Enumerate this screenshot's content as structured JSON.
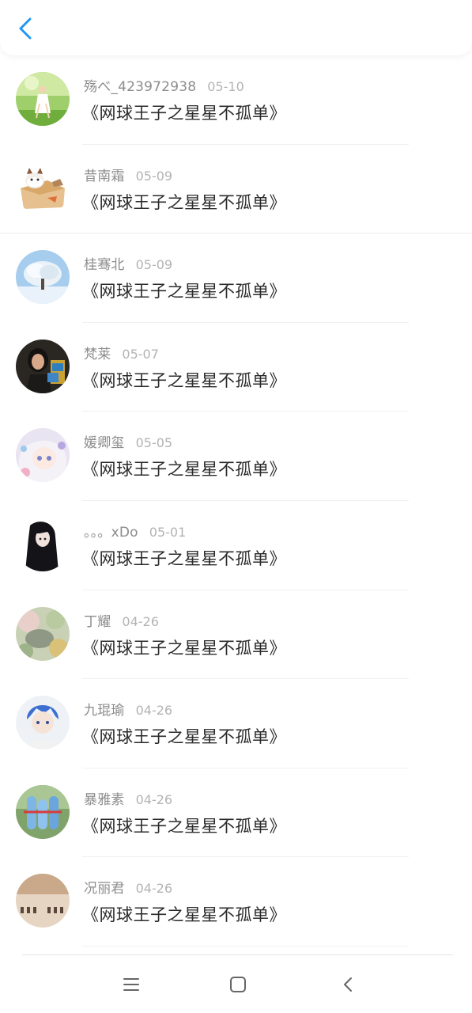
{
  "header": {
    "back_icon": "chevron-left-icon",
    "accent_color": "#2196f3"
  },
  "comments": [
    {
      "name": "殇べ_423972938",
      "date": "05-10",
      "title": "《网球王子之星星不孤单》",
      "avatar": "girl-in-meadow"
    },
    {
      "name": "昔南霜",
      "date": "05-09",
      "title": "《网球王子之星星不孤单》",
      "avatar": "cat-in-box"
    },
    {
      "name": "桂骞北",
      "date": "05-09",
      "title": "《网球王子之星星不孤单》",
      "avatar": "snowy-tree"
    },
    {
      "name": "梵莱",
      "date": "05-07",
      "title": "《网球王子之星星不孤单》",
      "avatar": "woman-portrait"
    },
    {
      "name": "媛卿玺",
      "date": "05-05",
      "title": "《网球王子之星星不孤单》",
      "avatar": "anime-girl"
    },
    {
      "name": "。。。xDo",
      "date": "05-01",
      "title": "《网球王子之星星不孤单》",
      "avatar": "dark-hair-girl"
    },
    {
      "name": "丁耀",
      "date": "04-26",
      "title": "《网球王子之星星不孤单》",
      "avatar": "painted-flowers"
    },
    {
      "name": "九琨瑜",
      "date": "04-26",
      "title": "《网球王子之星星不孤单》",
      "avatar": "anime-boy"
    },
    {
      "name": "暴雅素",
      "date": "04-26",
      "title": "《网球王子之星星不孤单》",
      "avatar": "blue-figurines"
    },
    {
      "name": "况丽君",
      "date": "04-26",
      "title": "《网球王子之星星不孤单》",
      "avatar": "calligraphy-paper"
    }
  ],
  "navbar": {
    "menu_icon": "menu-icon",
    "home_icon": "home-square-icon",
    "back_icon": "back-chevron-icon"
  }
}
